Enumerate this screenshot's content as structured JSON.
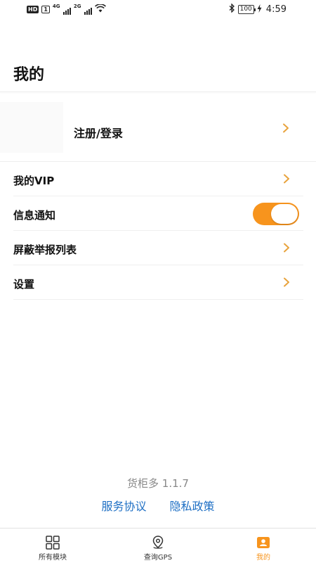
{
  "status_bar": {
    "hd": "HD",
    "sim": "1",
    "net1": "4G",
    "net2": "2G",
    "battery": "100",
    "time": "4:59"
  },
  "page": {
    "title": "我的"
  },
  "login": {
    "label": "注册/登录"
  },
  "menu": {
    "items": [
      {
        "label": "我的VIP",
        "control": "chevron"
      },
      {
        "label": "信息通知",
        "control": "toggle",
        "toggle_on": true
      },
      {
        "label": "屏蔽举报列表",
        "control": "chevron"
      },
      {
        "label": "设置",
        "control": "chevron"
      }
    ]
  },
  "footer": {
    "app_version": "货柜多 1.1.7",
    "service_agreement": "服务协议",
    "privacy_policy": "隐私政策"
  },
  "tabs": [
    {
      "label": "所有模块",
      "icon": "grid-icon",
      "active": false
    },
    {
      "label": "查询GPS",
      "icon": "location-pin-icon",
      "active": false
    },
    {
      "label": "我的",
      "icon": "profile-card-icon",
      "active": true
    }
  ],
  "colors": {
    "accent": "#f7941d",
    "link": "#1e6fc4",
    "chevron": "#e8a33d"
  }
}
